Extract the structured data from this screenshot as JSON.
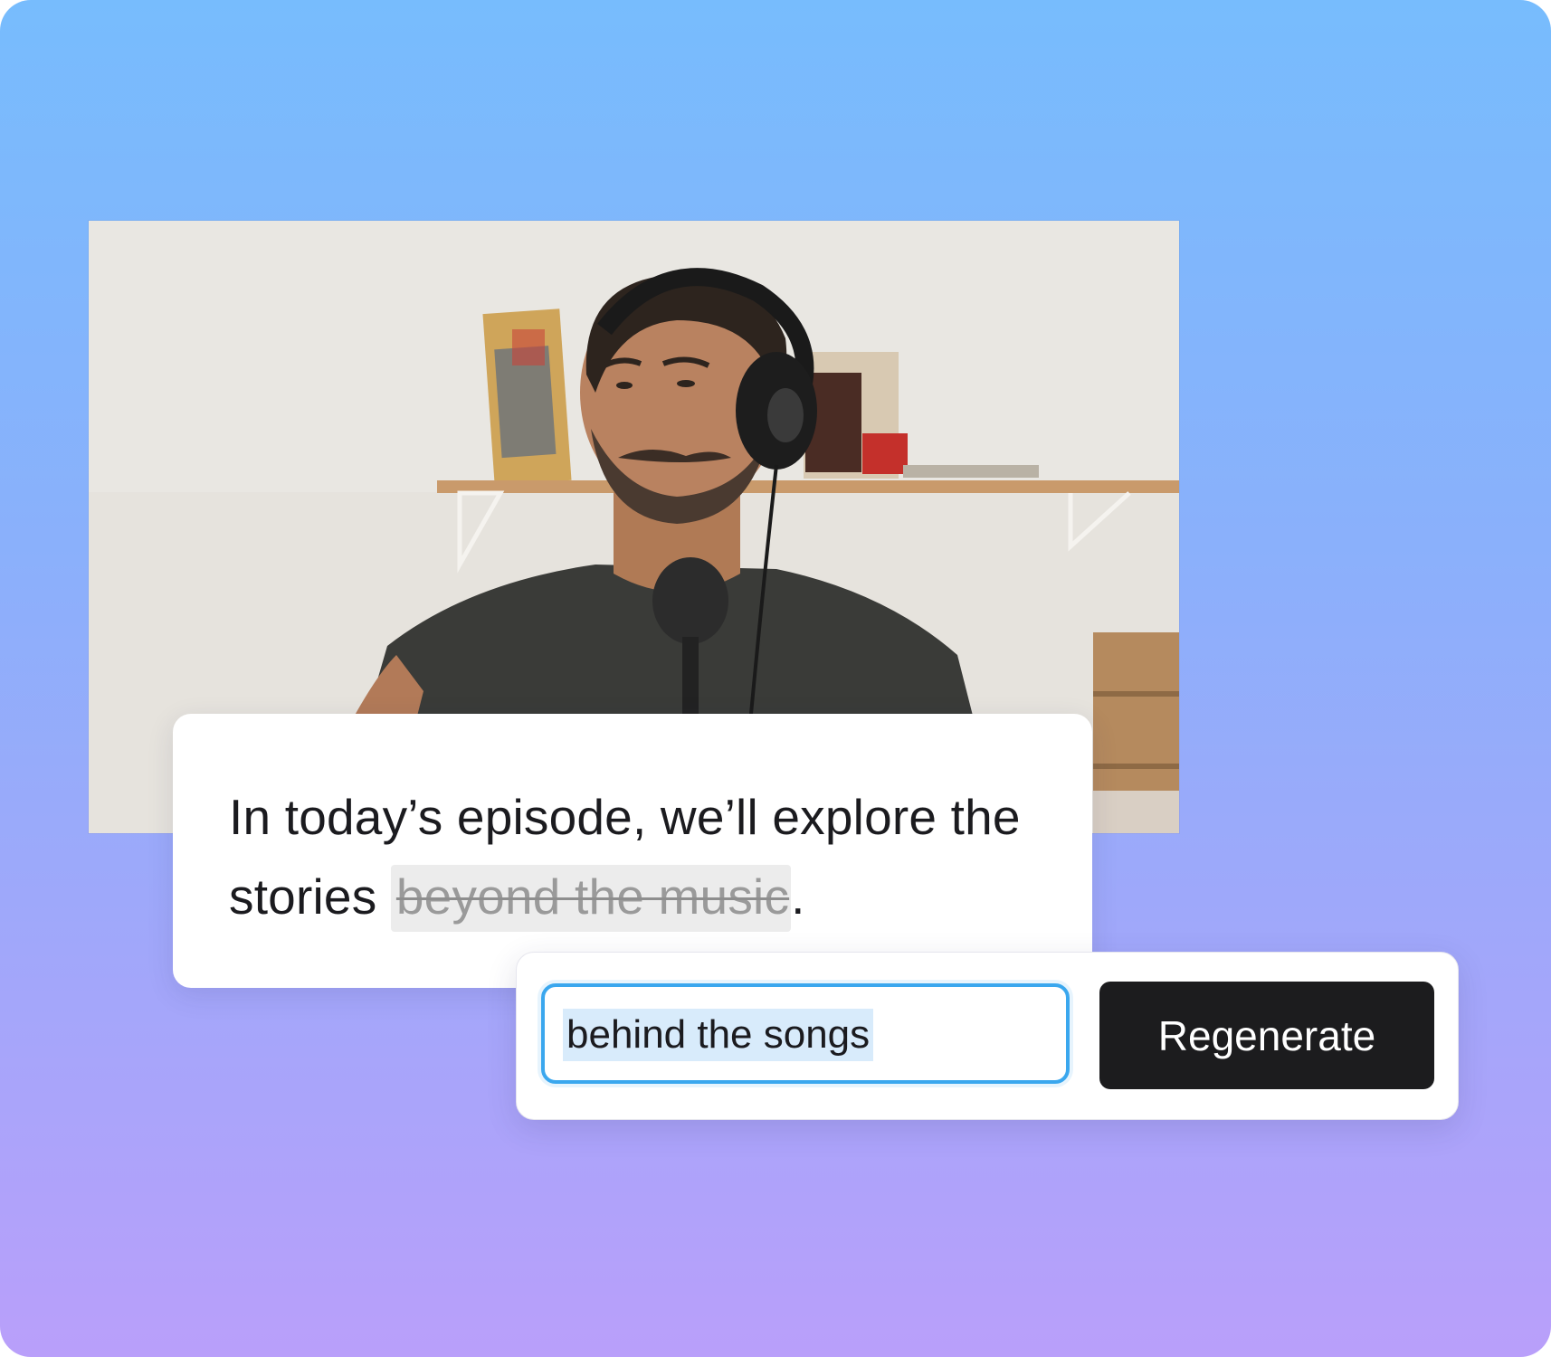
{
  "caption": {
    "text_before": "In today’s episode, we’ll explore the stories ",
    "struck_text": "beyond the music",
    "text_after": "."
  },
  "editor": {
    "input_value": "behind the songs",
    "regenerate_label": "Regenerate"
  },
  "colors": {
    "input_focus": "#3aa7ee",
    "button": "#1c1c1e",
    "gradient_top": "#77bcfd",
    "gradient_bottom": "#b99ffa"
  }
}
